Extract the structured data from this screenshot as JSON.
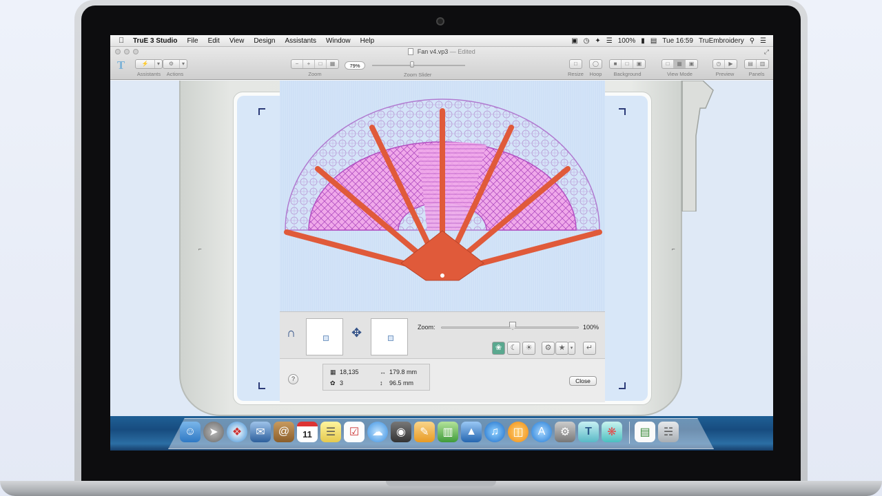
{
  "menubar": {
    "app_name": "TruE 3 Studio",
    "items": [
      "File",
      "Edit",
      "View",
      "Design",
      "Assistants",
      "Window",
      "Help"
    ],
    "battery": "100%",
    "clock": "Tue 16:59",
    "user": "TruEmbroidery"
  },
  "window": {
    "title": "Fan v4.vp3",
    "edited": "— Edited"
  },
  "toolbar": {
    "logo": "T",
    "assistants_label": "Assistants",
    "actions_label": "Actions",
    "zoom_label": "Zoom",
    "zoom_value": "79%",
    "zoom_slider_label": "Zoom Slider",
    "resize_label": "Resize",
    "hoop_label": "Hoop",
    "background_label": "Background",
    "view_mode_label": "View Mode",
    "preview_label": "Preview",
    "panels_label": "Panels"
  },
  "preview_panel": {
    "zoom_label": "Zoom:",
    "zoom_value": "100%",
    "zoom_level": 0.52,
    "stitch_count": "18,135",
    "color_count": "3",
    "width": "179.8 mm",
    "height": "96.5 mm",
    "help": "?",
    "close_label": "Close"
  },
  "colors": {
    "fan_ribs": "#e05a3a",
    "fan_fill": "#ee9ce6",
    "fan_outline": "#b07ad0",
    "fabric": "#d4e4f8"
  },
  "dock": {
    "apps": [
      "finder-icon",
      "launchpad-icon",
      "safari-icon",
      "mail-icon",
      "contacts-icon",
      "calendar-icon",
      "notes-icon",
      "reminders-icon",
      "messages-icon",
      "facetime-icon",
      "pages-icon",
      "numbers-icon",
      "keynote-icon",
      "itunes-icon",
      "ibooks-icon",
      "app-store-icon",
      "system-preferences-icon",
      "true-studio-icon",
      "truembroidery-icon",
      "document-icon",
      "trash-icon"
    ],
    "calendar_day": "11"
  }
}
